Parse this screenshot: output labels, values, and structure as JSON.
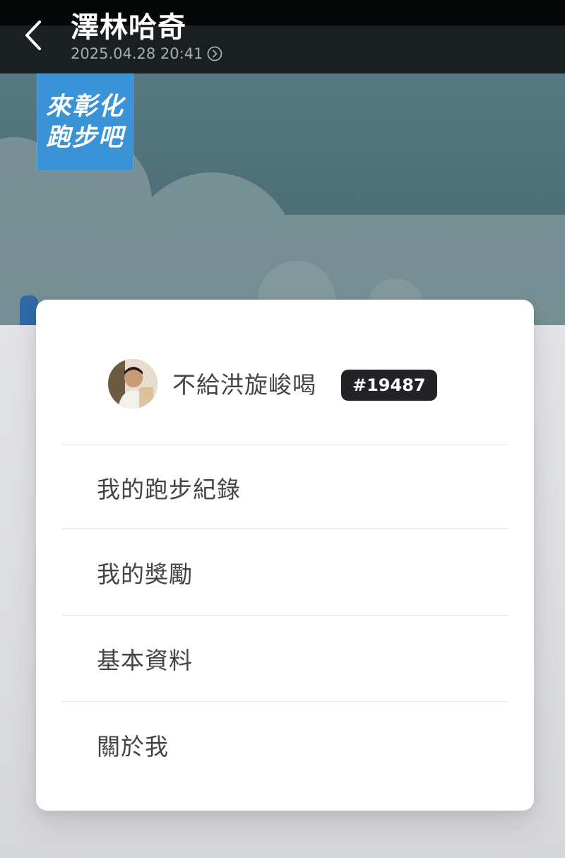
{
  "header": {
    "title": "澤林哈奇",
    "timestamp": "2025.04.28 20:41",
    "back_icon": "chevron-left-icon",
    "info_icon": "circle-chevron-right-icon"
  },
  "banner": {
    "logo_line1": "來彰化",
    "logo_line2": "跑步吧",
    "colors": {
      "sky": "#587983",
      "logo_bg": "#3a93d6"
    }
  },
  "profile": {
    "username": "不給洪旋峻喝",
    "rank": "#19487",
    "avatar_icon": "user-avatar"
  },
  "menu": {
    "items": [
      {
        "label": "我的跑步紀錄"
      },
      {
        "label": "我的獎勵"
      },
      {
        "label": "基本資料"
      },
      {
        "label": "關於我"
      }
    ]
  }
}
